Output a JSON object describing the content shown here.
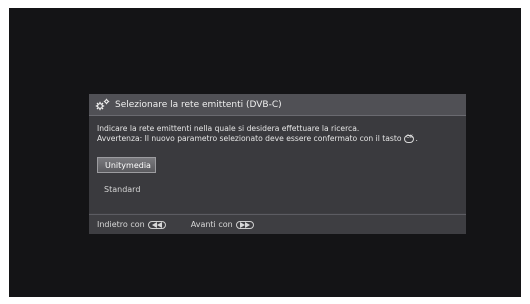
{
  "dialog": {
    "title": "Selezionare la rete emittenti (DVB-C)",
    "title_icon": "settings-gears-icon",
    "instruction_line1": "Indicare la rete emittenti nella quale si desidera effettuare la ricerca.",
    "instruction_line2": "Avvertenza: Il nuovo parametro selezionato deve essere confermato con il tasto",
    "ok_key_label": "OK",
    "instruction_end": ".",
    "options": [
      {
        "label": "Unitymedia",
        "selected": true
      },
      {
        "label": "Standard",
        "selected": false
      }
    ],
    "footer": {
      "back_label": "Indietro con",
      "back_icon": "rewind-icon",
      "forward_label": "Avanti con",
      "forward_icon": "fast-forward-icon"
    }
  },
  "colors": {
    "screen_bg": "#141416",
    "dialog_bg": "#3e3e42",
    "header_bg": "#505055",
    "selected_bg": "#6a6a6e"
  }
}
